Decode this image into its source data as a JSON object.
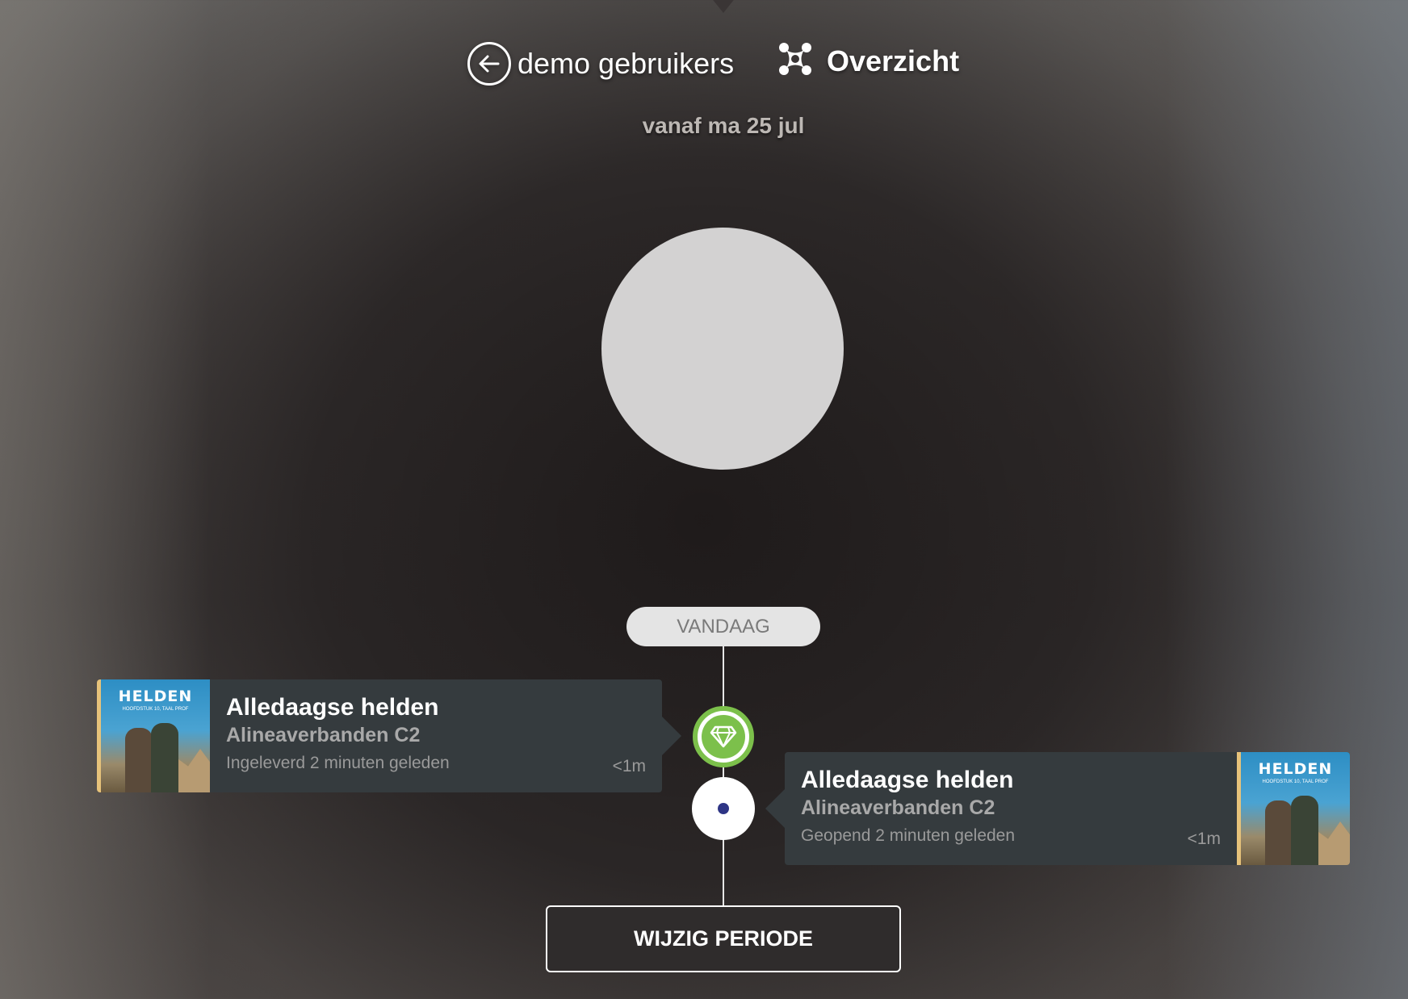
{
  "header": {
    "back_label": "demo gebruikers",
    "back_icon": "arrow-left-circle-icon",
    "overview_label": "Overzicht",
    "overview_icon": "overview-icon"
  },
  "period": {
    "text": "vanaf ma 25 jul"
  },
  "timeline": {
    "today_label": "VANDAAG",
    "events": [
      {
        "cover_title": "HELDEN",
        "cover_subtitle": "HOOFDSTUK 10, TAAL PROF",
        "title": "Alledaagse helden",
        "subtitle": "Alineaverbanden C2",
        "status": "Ingeleverd 2 minuten geleden",
        "duration": "<1m",
        "node_icon": "diamond-icon",
        "node_color": "#7cc04b"
      },
      {
        "cover_title": "HELDEN",
        "cover_subtitle": "HOOFDSTUK 10, TAAL PROF",
        "title": "Alledaagse helden",
        "subtitle": "Alineaverbanden C2",
        "status": "Geopend 2 minuten geleden",
        "duration": "<1m",
        "node_icon": "dot-icon",
        "node_color": "#2e3585"
      }
    ]
  },
  "actions": {
    "change_period_label": "WIJZIG PERIODE"
  },
  "colors": {
    "accent_green": "#7cc04b",
    "card_bg": "#353b3e",
    "cover_border": "#e6c27a"
  }
}
